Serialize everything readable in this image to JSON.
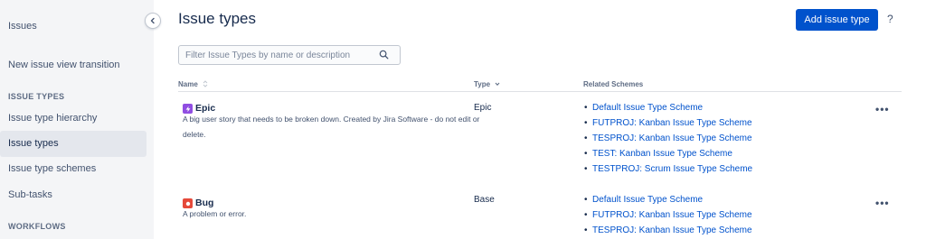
{
  "sidebar": {
    "heading": "Issues",
    "transition_link": "New issue view transition",
    "section_issue_types": "ISSUE TYPES",
    "items": [
      {
        "label": "Issue type hierarchy"
      },
      {
        "label": "Issue types",
        "active": true
      },
      {
        "label": "Issue type schemes"
      },
      {
        "label": "Sub-tasks"
      }
    ],
    "section_workflows": "WORKFLOWS"
  },
  "page": {
    "title": "Issue types",
    "add_button": "Add issue type",
    "help": "?"
  },
  "search": {
    "placeholder": "Filter Issue Types by name or description",
    "value": ""
  },
  "table": {
    "headers": {
      "name": "Name",
      "type": "Type",
      "schemes": "Related Schemes"
    },
    "sort_icons": {
      "name": "sort-neutral-icon",
      "type": "sort-down-icon"
    },
    "rows": [
      {
        "icon": "epic-lightning-icon",
        "icon_color": "#904ee2",
        "name": "Epic",
        "description": "A big user story that needs to be broken down. Created by Jira Software - do not edit or delete.",
        "type": "Epic",
        "schemes": [
          "Default Issue Type Scheme",
          "FUTPROJ: Kanban Issue Type Scheme",
          "TESPROJ: Kanban Issue Type Scheme",
          "TEST: Kanban Issue Type Scheme",
          "TESTPROJ: Scrum Issue Type Scheme"
        ],
        "more": "•••"
      },
      {
        "icon": "bug-icon",
        "icon_color": "#e5493a",
        "name": "Bug",
        "description": "A problem or error.",
        "type": "Base",
        "schemes": [
          "Default Issue Type Scheme",
          "FUTPROJ: Kanban Issue Type Scheme",
          "TESPROJ: Kanban Issue Type Scheme"
        ],
        "more": "•••"
      }
    ]
  },
  "colors": {
    "primary": "#0052cc",
    "sidebar_bg": "#f4f5f7",
    "sidebar_active": "#e4e7ed",
    "text": "#172b4d",
    "link": "#0052cc"
  }
}
